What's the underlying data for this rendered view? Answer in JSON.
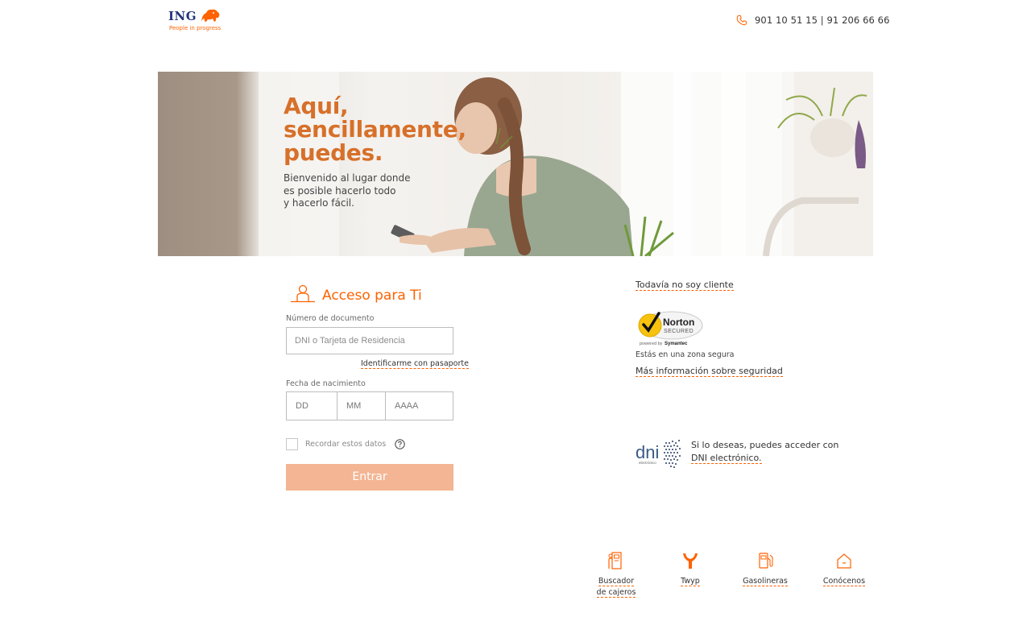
{
  "header": {
    "logo_text": "ING",
    "logo_tagline": "People in progress",
    "phone": "901 10 51 15 | 91 206 66 66"
  },
  "hero": {
    "title": "Aquí,\nsencillamente,\npuedes.",
    "subtitle": "Bienvenido al lugar donde\nes posible hacerlo todo\ny hacerlo fácil."
  },
  "login": {
    "title": "Acceso para Ti",
    "document_label": "Número de documento",
    "document_placeholder": "DNI o Tarjeta de Residencia",
    "passport_link": "Identificarme con pasaporte",
    "birth_label": "Fecha de nacimiento",
    "day_placeholder": "DD",
    "month_placeholder": "MM",
    "year_placeholder": "AAAA",
    "remember_label": "Recordar estos datos",
    "submit_label": "Entrar"
  },
  "side": {
    "not_client_link": "Todavía no soy cliente",
    "norton_brand": "Norton",
    "norton_secured": "SECURED",
    "norton_powered": "powered by",
    "norton_symantec": "Symantec",
    "secure_zone": "Estás en una zona segura",
    "security_link": "Más información sobre seguridad",
    "dni_logo_text": "dni",
    "dni_logo_sub": "electrónico",
    "dni_text": "Si lo deseas, puedes acceder con ",
    "dni_link": "DNI electrónico."
  },
  "footer": {
    "atm": "Buscador\nde cajeros",
    "twyp": "Twyp",
    "gas": "Gasolineras",
    "about": "Conócenos"
  },
  "colors": {
    "brand_orange": "#ff6200",
    "hero_orange": "#d7702a",
    "button_disabled": "#f3b593",
    "ing_blue": "#25347b"
  }
}
